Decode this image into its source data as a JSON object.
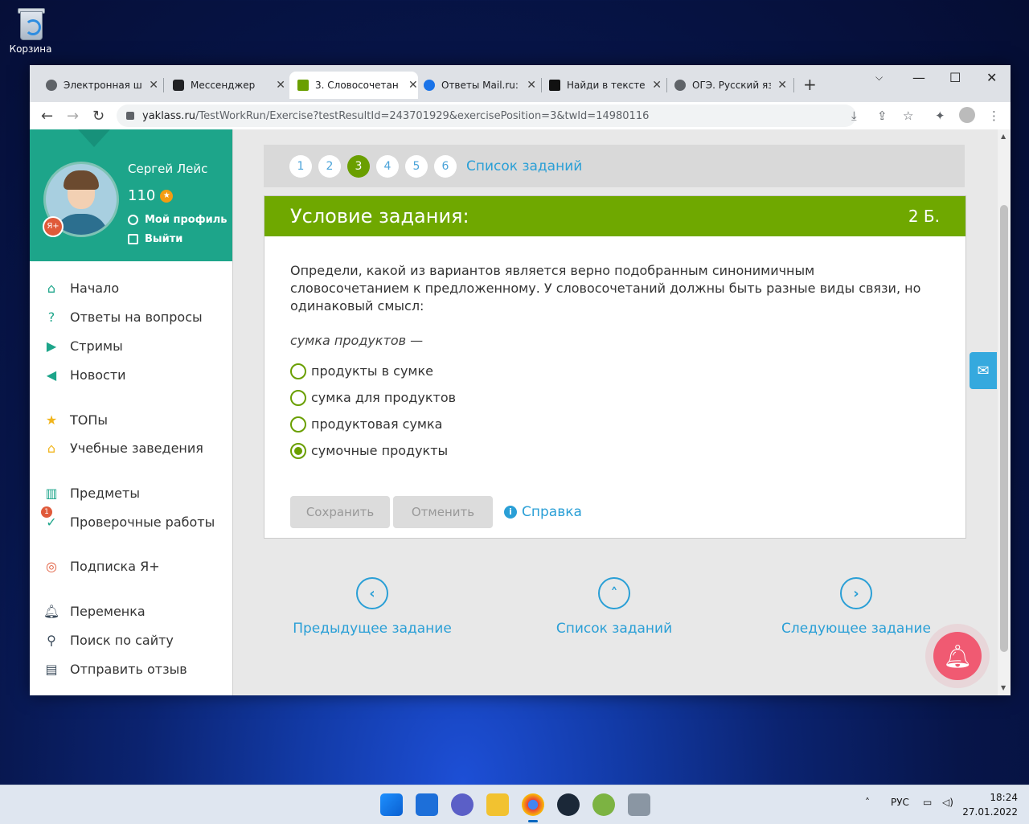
{
  "desktop": {
    "recycle_bin_label": "Корзина"
  },
  "browser": {
    "tabs": [
      {
        "title": "Электронная шк",
        "icon_color": "#5f6368",
        "active": false
      },
      {
        "title": "Мессенджер",
        "icon_color": "#202124",
        "active": false
      },
      {
        "title": "3. Словосочетан",
        "icon_color": "#6a9f00",
        "active": true
      },
      {
        "title": "Ответы Mail.ru: Ч",
        "icon_color": "#1a73e8",
        "active": false
      },
      {
        "title": "Найди в тексте с",
        "icon_color": "#111111",
        "active": false
      },
      {
        "title": "ОГЭ. Русский язы",
        "icon_color": "#5f6368",
        "active": false
      }
    ],
    "url_host": "yaklass.ru",
    "url_path": "/TestWorkRun/Exercise?testResultId=243701929&exercisePosition=3&twId=14980116"
  },
  "profile": {
    "name": "Сергей Лейс",
    "score": "110",
    "badge": "Я+",
    "profile_link": "Мой профиль",
    "logout_link": "Выйти"
  },
  "menu": [
    {
      "label": "Начало",
      "icon": "home-icon",
      "color": "#1da58a"
    },
    {
      "label": "Ответы на вопросы",
      "icon": "question-icon",
      "color": "#1da58a"
    },
    {
      "label": "Стримы",
      "icon": "play-icon",
      "color": "#1da58a"
    },
    {
      "label": "Новости",
      "icon": "megaphone-icon",
      "color": "#1da58a"
    },
    {
      "label": "ТОПы",
      "icon": "star-icon",
      "color": "#f1b51c"
    },
    {
      "label": "Учебные заведения",
      "icon": "school-icon",
      "color": "#f1b51c"
    },
    {
      "label": "Предметы",
      "icon": "books-icon",
      "color": "#1da58a"
    },
    {
      "label": "Проверочные работы",
      "icon": "check-icon",
      "color": "#1da58a",
      "badge": "1"
    },
    {
      "label": "Подписка Я+",
      "icon": "ya-plus-icon",
      "color": "#e05a3a"
    },
    {
      "label": "Переменка",
      "icon": "bell-icon",
      "color": "#3a4a5a"
    },
    {
      "label": "Поиск по сайту",
      "icon": "search-icon",
      "color": "#3a4a5a"
    },
    {
      "label": "Отправить отзыв",
      "icon": "comment-icon",
      "color": "#3a4a5a"
    }
  ],
  "pager": {
    "numbers": [
      "1",
      "2",
      "3",
      "4",
      "5",
      "6"
    ],
    "active_index": 2,
    "list_label": "Список заданий"
  },
  "task": {
    "header": "Условие задания:",
    "points": "2 Б.",
    "question": "Определи, какой из вариантов является верно подобранным синонимичным словосочетанием к предложенному. У словосочетаний должны быть разные виды связи, но одинаковый смысл:",
    "phrase": "сумка продуктов —",
    "options": [
      "продукты в сумке",
      "сумка для продуктов",
      "продуктовая сумка",
      "сумочные продукты"
    ],
    "selected_index": 3,
    "save_label": "Сохранить",
    "cancel_label": "Отменить",
    "help_label": "Справка"
  },
  "bottom_nav": {
    "prev": "Предыдущее задание",
    "list": "Список заданий",
    "next": "Следующее задание"
  },
  "taskbar": {
    "lang": "РУС",
    "time": "18:24",
    "date": "27.01.2022"
  }
}
